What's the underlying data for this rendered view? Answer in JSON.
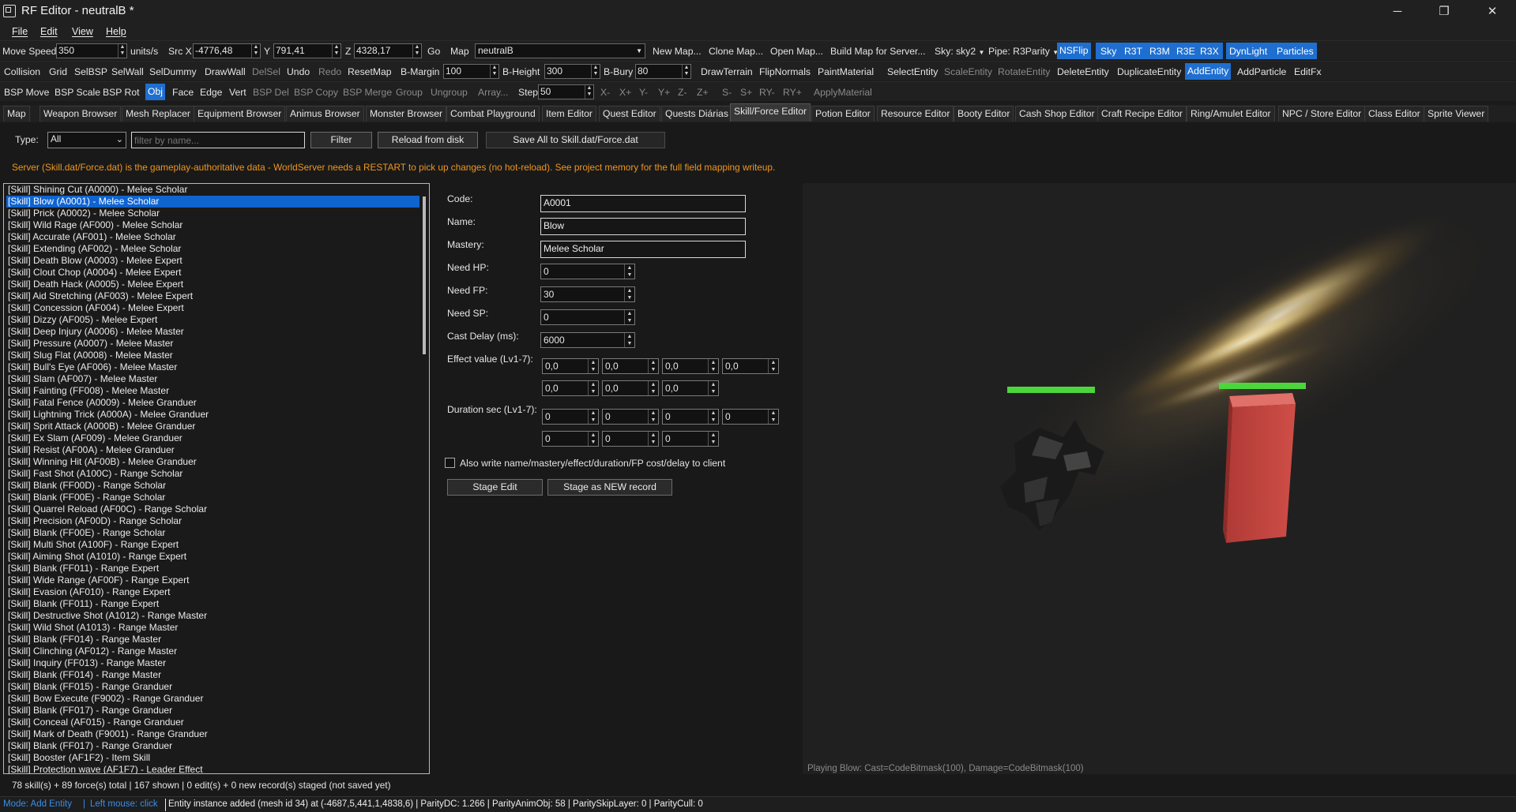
{
  "window": {
    "title": "RF Editor - neutralB *",
    "minimize": "─",
    "maximize": "❐",
    "close": "✕"
  },
  "menu": [
    "File",
    "Edit",
    "View",
    "Help"
  ],
  "toolbar1": {
    "move_speed_label": "Move Speed",
    "move_speed": "350",
    "units": "units/s",
    "src_label": "Src X",
    "src_x": "-4776,48",
    "y_label": "Y",
    "src_y": "791,41",
    "z_label": "Z",
    "src_z": "4328,17",
    "go": "Go",
    "map_label": "Map",
    "map_value": "neutralB",
    "new_map": "New Map...",
    "clone_map": "Clone Map...",
    "open_map": "Open Map...",
    "build_map": "Build Map for Server...",
    "sky": "Sky: sky2",
    "pipe": "Pipe: R3Parity",
    "nsflip": "NSFlip",
    "sky_btn": "Sky",
    "r3t": "R3T",
    "r3m": "R3M",
    "r3e": "R3E",
    "r3x": "R3X",
    "dynlight": "DynLight",
    "particles": "Particles"
  },
  "toolbar2": {
    "collision": "Collision",
    "grid": "Grid",
    "selbsp": "SelBSP",
    "selwall": "SelWall",
    "seldummy": "SelDummy",
    "drawwall": "DrawWall",
    "delsel": "DelSel",
    "undo": "Undo",
    "redo": "Redo",
    "resetmap": "ResetMap",
    "bmargin_label": "B-Margin",
    "bmargin": "100",
    "bheight_label": "B-Height",
    "bheight": "300",
    "bbury_label": "B-Bury",
    "bbury": "80",
    "drawterrain": "DrawTerrain",
    "flipnormals": "FlipNormals",
    "paintmaterial": "PaintMaterial",
    "selectentity": "SelectEntity",
    "scaleentity": "ScaleEntity",
    "rotateentity": "RotateEntity",
    "deleteentity": "DeleteEntity",
    "duplicateentity": "DuplicateEntity",
    "addentity": "AddEntity",
    "addparticle": "AddParticle",
    "editfx": "EditFx"
  },
  "toolbar3": {
    "bspmove": "BSP Move",
    "bspscale": "BSP Scale",
    "bsprot": "BSP Rot",
    "obj": "Obj",
    "face": "Face",
    "edge": "Edge",
    "vert": "Vert",
    "bspdel": "BSP Del",
    "bspcopy": "BSP Copy",
    "bspmerge": "BSP Merge",
    "group": "Group",
    "ungroup": "Ungroup",
    "array": "Array...",
    "step_label": "Step",
    "step": "50",
    "xm": "X-",
    "xp": "X+",
    "ym": "Y-",
    "yp": "Y+",
    "zm": "Z-",
    "zp": "Z+",
    "sm": "S-",
    "sp": "S+",
    "rym": "RY-",
    "ryp": "RY+",
    "applymaterial": "ApplyMaterial"
  },
  "tabs": [
    "Map",
    "Weapon Browser",
    "Mesh Replacer",
    "Equipment Browser",
    "Animus Browser",
    "Monster Browser",
    "Combat Playground",
    "Item Editor",
    "Quest Editor",
    "Quests Diárias",
    "Skill/Force Editor",
    "Potion Editor",
    "Resource Editor",
    "Booty Editor",
    "Cash Shop Editor",
    "Craft Recipe Editor",
    "Ring/Amulet Editor",
    "NPC / Store Editor",
    "Class Editor",
    "Sprite Viewer"
  ],
  "filters": {
    "type_label": "Type:",
    "type_value": "All",
    "filter_placeholder": "filter by name...",
    "filter_btn": "Filter",
    "reload_btn": "Reload from disk",
    "save_all_btn": "Save All to Skill.dat/Force.dat"
  },
  "warning": "Server (Skill.dat/Force.dat) is the gameplay-authoritative data - WorldServer needs a RESTART to pick up changes (no hot-reload). See project memory for the full field mapping writeup.",
  "skills": [
    "[Skill] Shining Cut (A0000) - Melee Scholar",
    "[Skill] Blow (A0001) - Melee Scholar",
    "[Skill] Prick (A0002) - Melee Scholar",
    "[Skill] Wild Rage (AF000) - Melee Scholar",
    "[Skill] Accurate (AF001) - Melee Scholar",
    "[Skill] Extending (AF002) - Melee Scholar",
    "[Skill] Death Blow (A0003) - Melee Expert",
    "[Skill] Clout Chop (A0004) - Melee Expert",
    "[Skill] Death Hack (A0005) - Melee Expert",
    "[Skill] Aid Stretching (AF003) - Melee Expert",
    "[Skill] Concession (AF004) - Melee Expert",
    "[Skill] Dizzy (AF005) - Melee Expert",
    "[Skill] Deep Injury (A0006) - Melee Master",
    "[Skill] Pressure (A0007) - Melee Master",
    "[Skill] Slug Flat (A0008) - Melee Master",
    "[Skill] Bull's Eye (AF006) - Melee Master",
    "[Skill] Slam (AF007) - Melee Master",
    "[Skill] Fainting (FF008) - Melee Master",
    "[Skill] Fatal Fence (A0009) - Melee Granduer",
    "[Skill] Lightning Trick (A000A) - Melee Granduer",
    "[Skill] Sprit Attack (A000B) - Melee Granduer",
    "[Skill] Ex Slam (AF009) - Melee Granduer",
    "[Skill] Resist (AF00A) - Melee Granduer",
    "[Skill] Winning Hit (AF00B) - Melee Granduer",
    "[Skill] Fast Shot (A100C) - Range Scholar",
    "[Skill] Blank (FF00D) - Range Scholar",
    "[Skill] Blank (FF00E) - Range Scholar",
    "[Skill] Quarrel Reload (AF00C) - Range Scholar",
    "[Skill] Precision (AF00D) - Range Scholar",
    "[Skill] Blank (FF00E) - Range Scholar",
    "[Skill] Multi Shot (A100F) - Range Expert",
    "[Skill] Aiming Shot (A1010) - Range Expert",
    "[Skill] Blank (FF011) - Range Expert",
    "[Skill] Wide Range (AF00F) - Range Expert",
    "[Skill] Evasion (AF010) - Range Expert",
    "[Skill] Blank (FF011) - Range Expert",
    "[Skill] Destructive Shot (A1012) - Range Master",
    "[Skill] Wild Shot (A1013) - Range Master",
    "[Skill] Blank (FF014) - Range Master",
    "[Skill] Clinching (AF012) - Range Master",
    "[Skill] Inquiry (FF013) - Range Master",
    "[Skill] Blank (FF014) - Range Master",
    "[Skill] Blank (FF015) - Range Granduer",
    "[Skill] Bow Execute (F9002) - Range Granduer",
    "[Skill] Blank (FF017) - Range Granduer",
    "[Skill] Conceal (AF015) - Range Granduer",
    "[Skill] Mark of Death (F9001) - Range Granduer",
    "[Skill] Blank (FF017) - Range Granduer",
    "[Skill] Booster (AF1F2) - Item Skill",
    "[Skill] Protection wave (AF1F7) - Leader Effect"
  ],
  "selected_index": 1,
  "form": {
    "code_label": "Code:",
    "code": "A0001",
    "name_label": "Name:",
    "name": "Blow",
    "mastery_label": "Mastery:",
    "mastery": "Melee Scholar",
    "needhp_label": "Need HP:",
    "needhp": "0",
    "needfp_label": "Need FP:",
    "needfp": "30",
    "needsp_label": "Need SP:",
    "needsp": "0",
    "castdelay_label": "Cast Delay (ms):",
    "castdelay": "6000",
    "effect_label": "Effect value (Lv1-7):",
    "effect": [
      "0,0",
      "0,0",
      "0,0",
      "0,0",
      "0,0",
      "0,0",
      "0,0"
    ],
    "duration_label": "Duration sec (Lv1-7):",
    "duration": [
      "0",
      "0",
      "0",
      "0",
      "0",
      "0",
      "0"
    ],
    "also_write": "Also write name/mastery/effect/duration/FP cost/delay to client",
    "stage_edit": "Stage Edit",
    "stage_new": "Stage as NEW record"
  },
  "viewport_caption": "Playing Blow: Cast=CodeBitmask(100), Damage=CodeBitmask(100)",
  "list_status": "78 skill(s) + 89 force(s) total | 167 shown | 0 edit(s) + 0 new record(s) staged (not saved yet)",
  "statusbar": {
    "mode": "Mode: Add Entity",
    "separator": "|",
    "left_mouse": "Left mouse: click",
    "info": "Entity instance added (mesh id 34) at (-4687,5,441,1,4838,6) | ParityDC: 1.266 | ParityAnimObj: 58 | ParitySkipLayer: 0 | ParityCull: 0"
  },
  "colors": {
    "accent": "#1f6fd0",
    "warning": "#f0961e",
    "health_bar": "#4cd63c",
    "entity_box": "#c84a44"
  }
}
